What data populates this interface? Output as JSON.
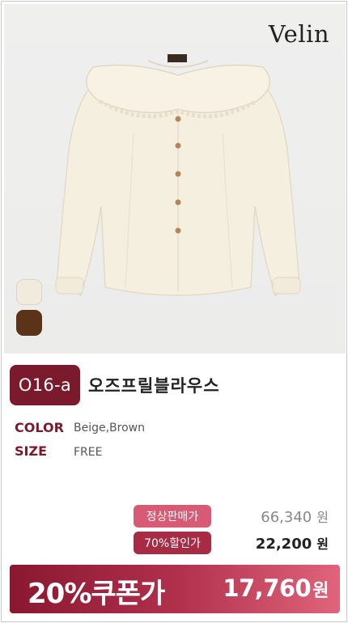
{
  "brand": "Velin",
  "product": {
    "code": "O16-a",
    "name": "오즈프릴블라우스"
  },
  "swatches": [
    {
      "name": "beige",
      "color": "#f0ebdd"
    },
    {
      "name": "brown",
      "color": "#5a3318"
    }
  ],
  "specs": {
    "color_label": "COLOR",
    "color_value": "Beige,Brown",
    "size_label": "SIZE",
    "size_value": "FREE"
  },
  "pricing": {
    "regular_label": "정상판매가",
    "regular_price": "66,340",
    "discount_label": "70%할인가",
    "discount_price": "22,200",
    "currency": "원"
  },
  "coupon": {
    "label": "20%쿠폰가",
    "price": "17,760",
    "currency": "원"
  },
  "colors": {
    "accent": "#7c1a2d",
    "pill_regular": "#d85a74",
    "pill_discount": "#a82a45"
  }
}
